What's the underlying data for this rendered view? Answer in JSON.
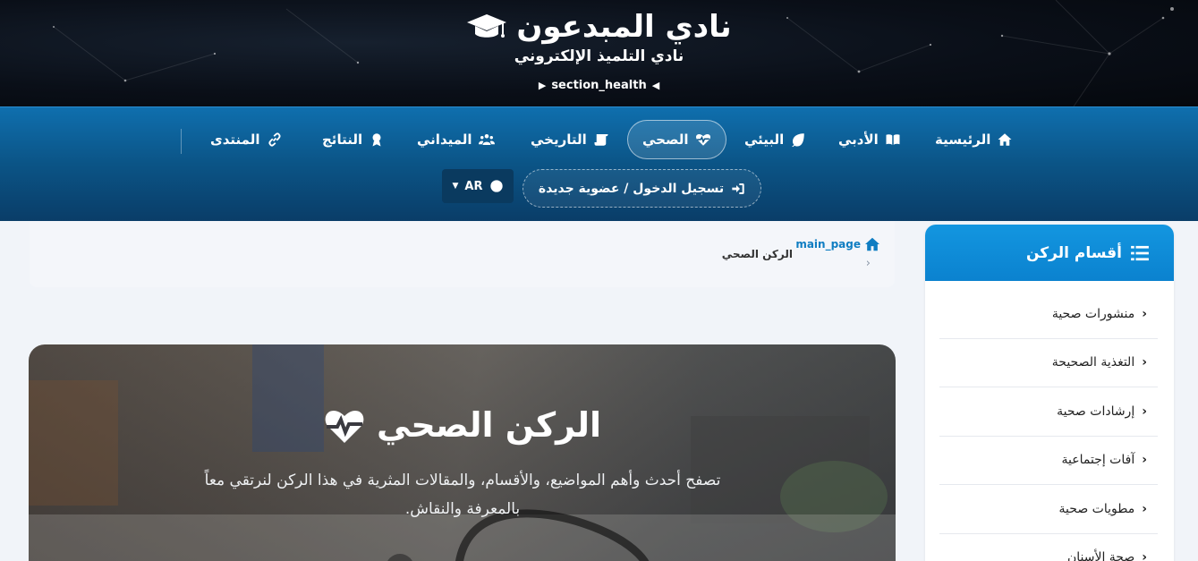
{
  "header": {
    "site_title": "نادي المبدعون",
    "site_subtitle": "نادي التلميذ الإلكتروني",
    "section_label": "section_health",
    "logo_icon": "graduation-cap-icon"
  },
  "nav": {
    "items": [
      {
        "label": "الرئيسية",
        "icon": "home-icon"
      },
      {
        "label": "الأدبي",
        "icon": "book-icon"
      },
      {
        "label": "البيئي",
        "icon": "leaf-icon"
      },
      {
        "label": "الصحي",
        "icon": "heartbeat-icon",
        "active": true
      },
      {
        "label": "التاريخي",
        "icon": "scroll-icon"
      },
      {
        "label": "الميداني",
        "icon": "users-icon"
      },
      {
        "label": "النتائج",
        "icon": "award-icon"
      },
      {
        "label": "المنتدى",
        "icon": "link-icon"
      }
    ],
    "login_label": "تسجيل الدخول / عضوية جديدة",
    "lang_label": "AR"
  },
  "breadcrumb": {
    "home_label": "main_page",
    "separator": "‹",
    "current": "الركن الصحي"
  },
  "hero": {
    "title": "الركن الصحي",
    "description": "تصفح أحدث وأهم المواضيع، والأقسام، والمقالات المثرية في هذا الركن لنرتقي معاً بالمعرفة والنقاش."
  },
  "sidebar": {
    "title": "أقسام الركن",
    "items": [
      "منشورات صحية",
      "التغذية الصحيحة",
      "إرشادات صحية",
      "آفات إجتماعية",
      "مطويات صحية",
      "صحة الأسنان"
    ]
  },
  "colors": {
    "accent": "#0f7dc2",
    "nav_top": "#0f6fae",
    "nav_bottom": "#0a3d68",
    "header_bg": "#0a0f18"
  }
}
